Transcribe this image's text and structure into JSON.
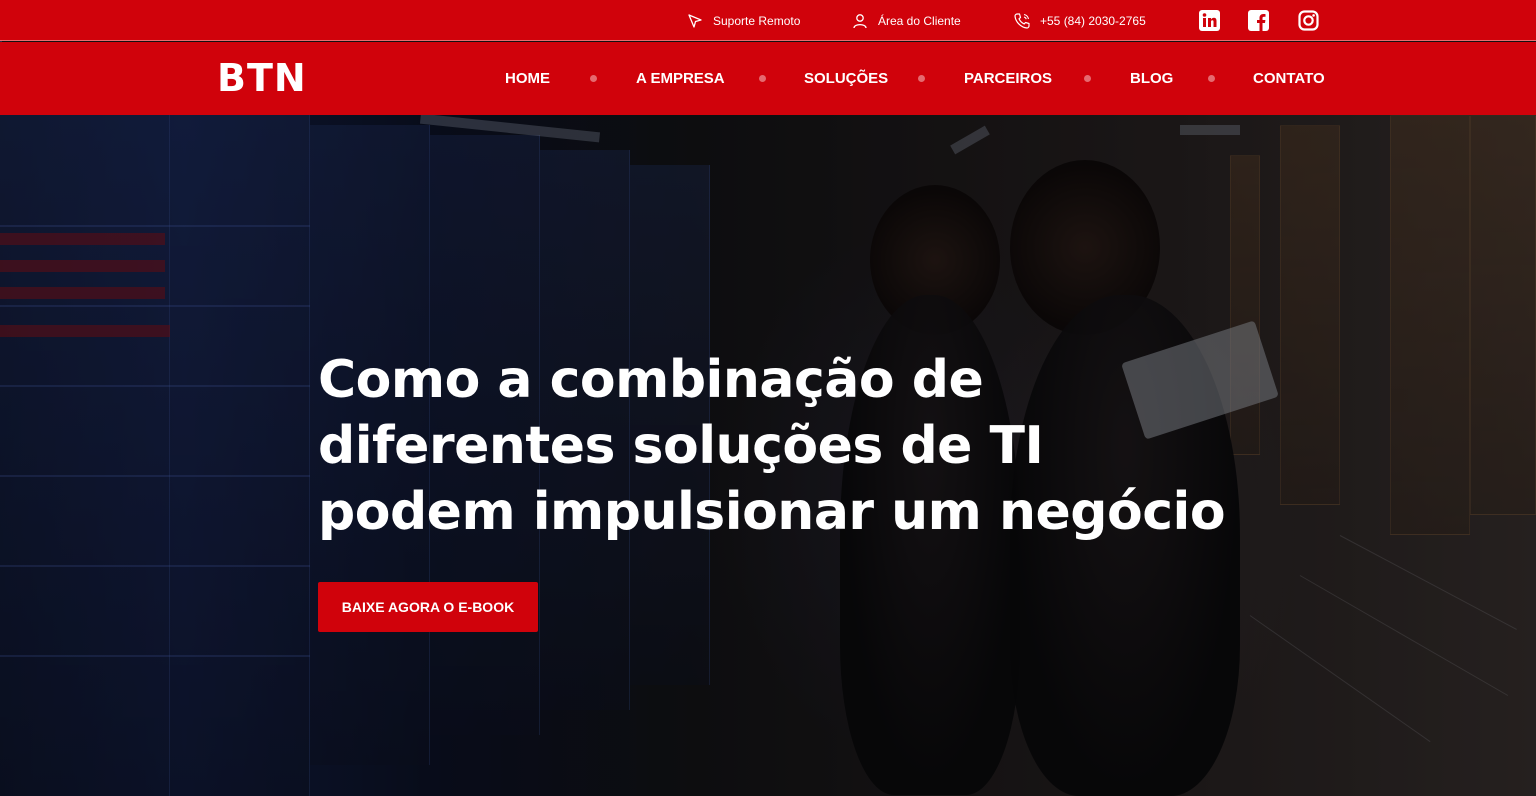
{
  "topbar": {
    "suporte_label": "Suporte Remoto",
    "cliente_label": "Área do Cliente",
    "phone_label": "+55 (84) 2030-2765",
    "icons": {
      "suporte": "cursor-arrow-icon",
      "cliente": "user-icon",
      "phone": "phone-icon"
    },
    "social": [
      "linkedin-icon",
      "facebook-icon",
      "instagram-icon"
    ]
  },
  "nav": {
    "logo": "BTN",
    "items": [
      "HOME",
      "A EMPRESA",
      "SOLUÇÕES",
      "PARCEIROS",
      "BLOG",
      "CONTATO"
    ]
  },
  "hero": {
    "title": "Como a combinação de diferentes soluções de TI podem impulsionar um negócio",
    "cta_label": "BAIXE AGORA O E-BOOK"
  },
  "colors": {
    "brand_red": "#d0020b",
    "nav_dot": "#e56a6f",
    "text": "#ffffff"
  }
}
